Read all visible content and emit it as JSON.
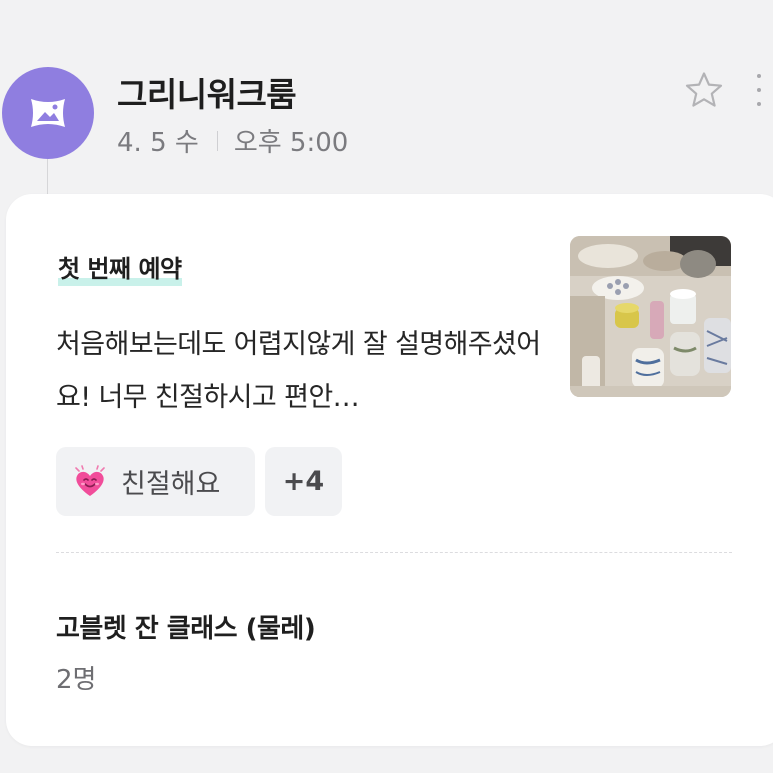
{
  "header": {
    "shop_name": "그리니워크룸",
    "date": "4. 5 수",
    "time": "오후 5:00",
    "avatar_color": "#8f7ee0",
    "avatar_icon": "image-placeholder-icon",
    "star_icon": "star-outline-icon",
    "more_icon": "more-vertical-icon"
  },
  "review": {
    "title": "첫 번째 예약",
    "text": "처음해보는데도 어렵지않게 잘 설명해주셨어요! 너무 친절하시고 편안…",
    "thumbnail": "pottery-class-photo",
    "tags": [
      {
        "label": "친절해요",
        "icon": "smiling-heart-icon"
      }
    ],
    "more_tags": "+4",
    "highlight_color": "#c9f1ea"
  },
  "booking": {
    "class_name": "고블렛 잔 클래스 (물레)",
    "people": "2명"
  }
}
